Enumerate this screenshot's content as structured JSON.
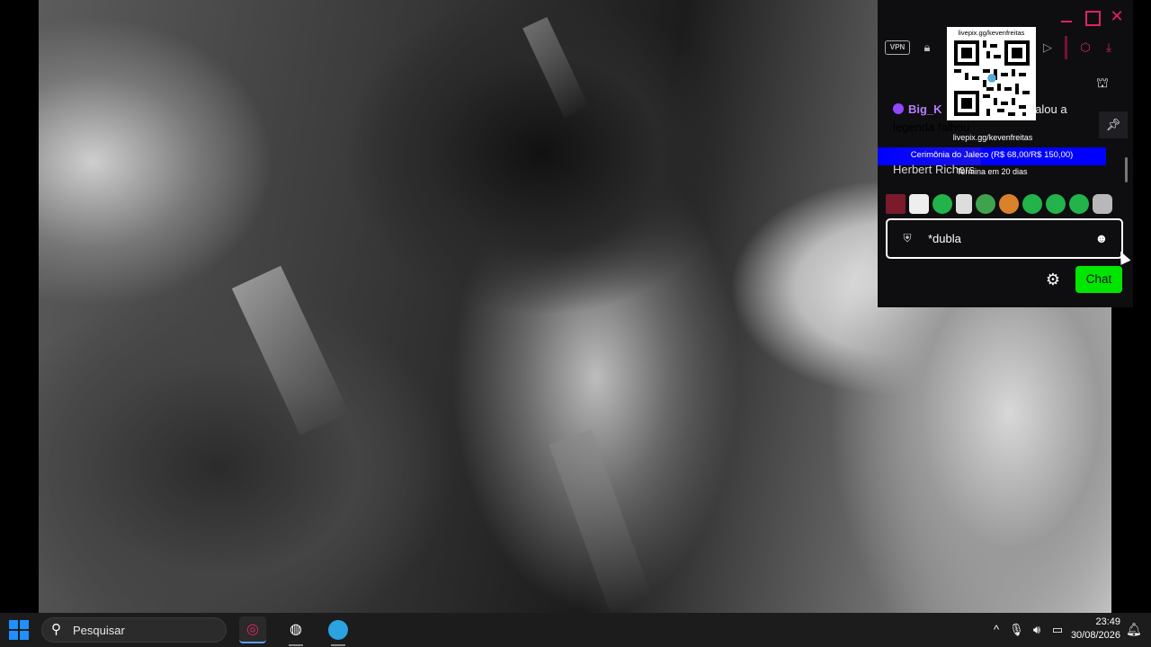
{
  "window": {
    "minimize": "—",
    "maximize": "□",
    "close": "✕"
  },
  "toolbar": {
    "vpn_label": "VPN"
  },
  "qr": {
    "label_top": "livepix.gg/kevenfreitas",
    "label_bottom": "livepix.gg/kevenfreitas"
  },
  "chat": {
    "messages": [
      {
        "user": "Big_K",
        "suffix": "falou a",
        "text": "legenda falhou"
      }
    ],
    "goal": {
      "text": "Cerimônia do Jaleco (R$ 68,00/R$ 150,00)",
      "ends": "Termina em 20 dias",
      "progress": 0.45
    },
    "second_user": "Herbert Richers",
    "input_value": "*dubla",
    "send_label": "Chat"
  },
  "taskbar": {
    "search_placeholder": "Pesquisar",
    "time": "23:49",
    "date": "30/08/2026"
  },
  "colors": {
    "accent_pink": "#e0245e",
    "chat_button": "#00e600",
    "goal_blue": "#0000ff",
    "windows_blue": "#1e90ff"
  }
}
